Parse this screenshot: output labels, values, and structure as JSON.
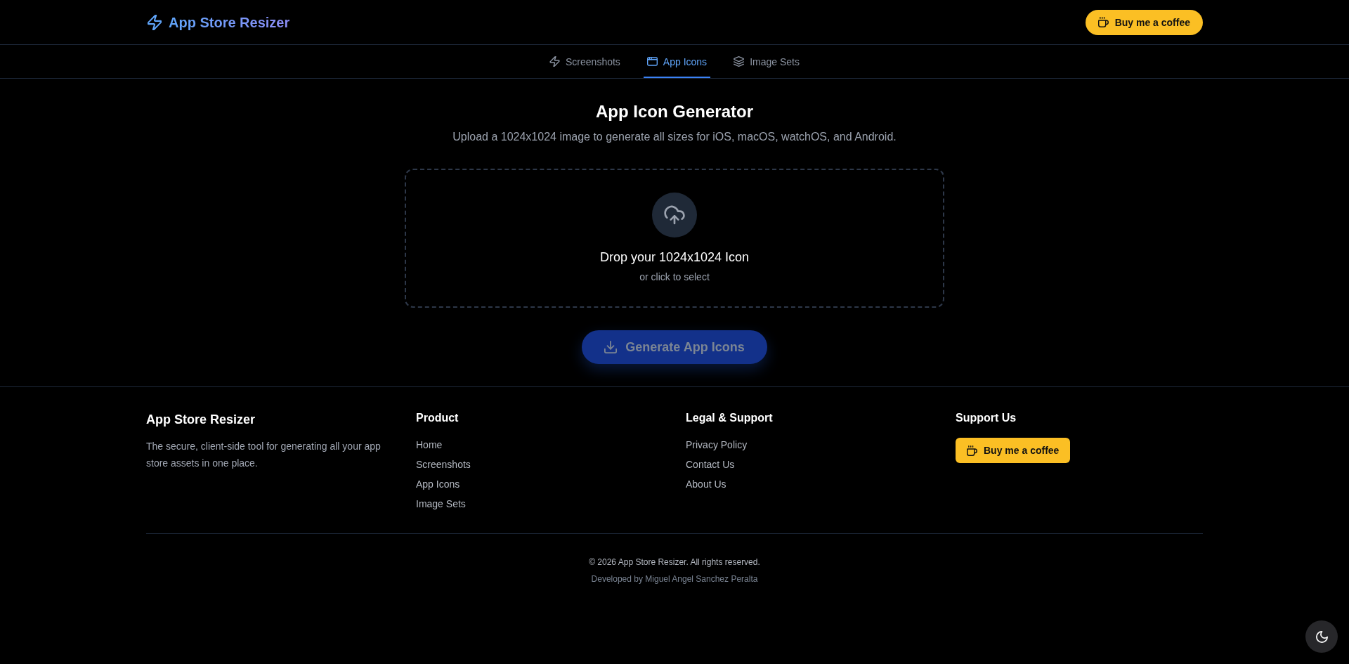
{
  "header": {
    "brand": "App Store Resizer",
    "coffee_button": "Buy me a coffee"
  },
  "tabs": [
    {
      "label": "Screenshots",
      "selected": false
    },
    {
      "label": "App Icons",
      "selected": true
    },
    {
      "label": "Image Sets",
      "selected": false
    }
  ],
  "main": {
    "title": "App Icon Generator",
    "subtitle": "Upload a 1024x1024 image to generate all sizes for iOS, macOS, watchOS, and Android.",
    "dropzone": {
      "title": "Drop your 1024x1024 Icon",
      "hint": "or click to select"
    },
    "generate_button": {
      "label": "Generate App Icons",
      "disabled": true
    }
  },
  "footer": {
    "brand": {
      "title": "App Store Resizer",
      "description": "The secure, client-side tool for generating all your app store assets in one place."
    },
    "product": {
      "heading": "Product",
      "links": [
        "Home",
        "Screenshots",
        "App Icons",
        "Image Sets"
      ]
    },
    "legal": {
      "heading": "Legal & Support",
      "links": [
        "Privacy Policy",
        "Contact Us",
        "About Us"
      ]
    },
    "support": {
      "heading": "Support Us",
      "button": "Buy me a coffee"
    },
    "copyright": "© 2026 App Store Resizer. All rights reserved.",
    "credit": "Developed by Miguel Angel Sanchez Peralta"
  }
}
